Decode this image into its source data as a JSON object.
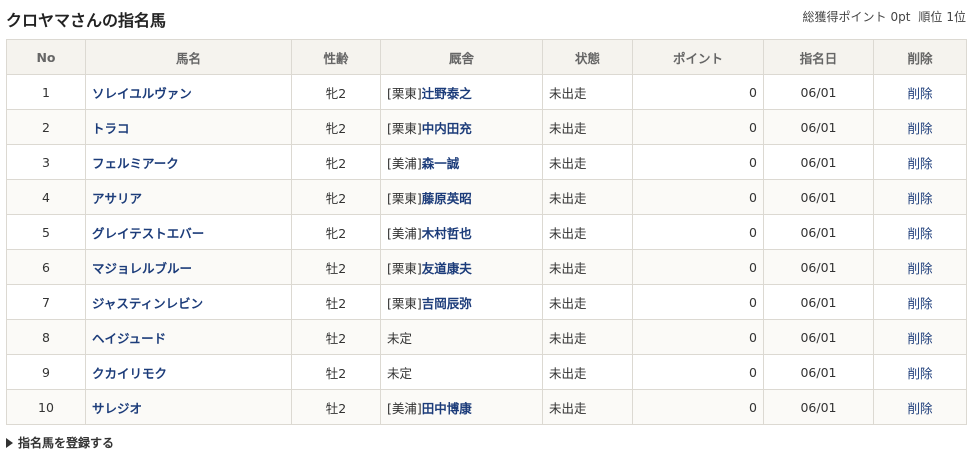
{
  "header": {
    "title": "クロヤマさんの指名馬",
    "summary_points_label": "総獲得ポイント",
    "summary_points_value": "0pt",
    "summary_rank_label": "順位",
    "summary_rank_value": "1位"
  },
  "table": {
    "headers": {
      "no": "No",
      "name": "馬名",
      "sex_age": "性齢",
      "stable": "厩舎",
      "status": "状態",
      "points": "ポイント",
      "date": "指名日",
      "delete": "削除"
    },
    "rows": [
      {
        "no": "1",
        "name": "ソレイユルヴァン",
        "sex_age": "牝2",
        "region": "[栗東]",
        "trainer": "辻野泰之",
        "status": "未出走",
        "points": "0",
        "date": "06/01",
        "delete": "削除"
      },
      {
        "no": "2",
        "name": "トラコ",
        "sex_age": "牝2",
        "region": "[栗東]",
        "trainer": "中内田充",
        "status": "未出走",
        "points": "0",
        "date": "06/01",
        "delete": "削除"
      },
      {
        "no": "3",
        "name": "フェルミアーク",
        "sex_age": "牝2",
        "region": "[美浦]",
        "trainer": "森一誠",
        "status": "未出走",
        "points": "0",
        "date": "06/01",
        "delete": "削除"
      },
      {
        "no": "4",
        "name": "アサリア",
        "sex_age": "牝2",
        "region": "[栗東]",
        "trainer": "藤原英昭",
        "status": "未出走",
        "points": "0",
        "date": "06/01",
        "delete": "削除"
      },
      {
        "no": "5",
        "name": "グレイテストエバー",
        "sex_age": "牝2",
        "region": "[美浦]",
        "trainer": "木村哲也",
        "status": "未出走",
        "points": "0",
        "date": "06/01",
        "delete": "削除"
      },
      {
        "no": "6",
        "name": "マジョレルブルー",
        "sex_age": "牡2",
        "region": "[栗東]",
        "trainer": "友道康夫",
        "status": "未出走",
        "points": "0",
        "date": "06/01",
        "delete": "削除"
      },
      {
        "no": "7",
        "name": "ジャスティンレビン",
        "sex_age": "牡2",
        "region": "[栗東]",
        "trainer": "吉岡辰弥",
        "status": "未出走",
        "points": "0",
        "date": "06/01",
        "delete": "削除"
      },
      {
        "no": "8",
        "name": "ヘイジュード",
        "sex_age": "牡2",
        "region": "未定",
        "trainer": "",
        "status": "未出走",
        "points": "0",
        "date": "06/01",
        "delete": "削除"
      },
      {
        "no": "9",
        "name": "クカイリモク",
        "sex_age": "牡2",
        "region": "未定",
        "trainer": "",
        "status": "未出走",
        "points": "0",
        "date": "06/01",
        "delete": "削除"
      },
      {
        "no": "10",
        "name": "サレジオ",
        "sex_age": "牡2",
        "region": "[美浦]",
        "trainer": "田中博康",
        "status": "未出走",
        "points": "0",
        "date": "06/01",
        "delete": "削除"
      }
    ]
  },
  "footer": {
    "register_icon": "triangle-right-icon",
    "register_label": "指名馬を登録する"
  },
  "colors": {
    "link": "#1c3c7a",
    "header_bg": "#f5f3ee",
    "border": "#dcd9d2"
  }
}
